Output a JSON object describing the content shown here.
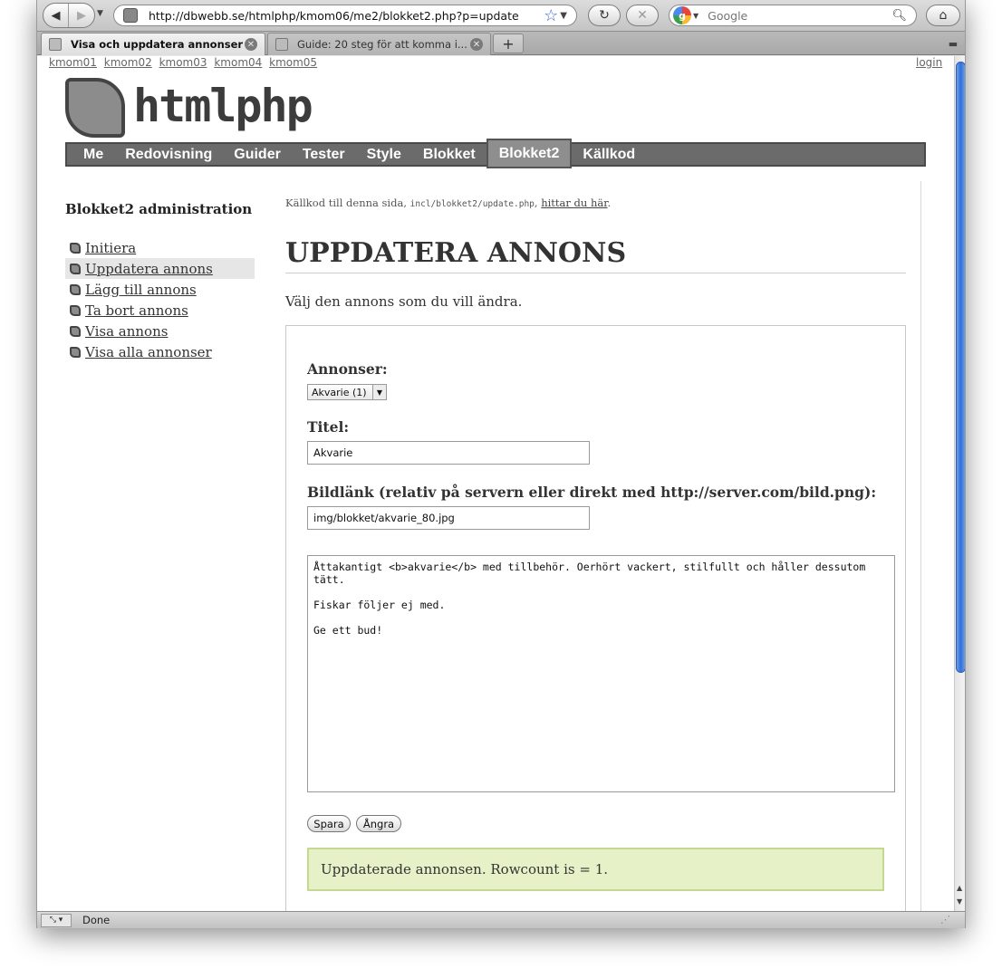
{
  "browser": {
    "url": "http://dbwebb.se/htmlphp/kmom06/me2/blokket2.php?p=update",
    "search_placeholder": "Google",
    "tabs": [
      {
        "title": "Visa och uppdatera annonser"
      },
      {
        "title": "Guide: 20 steg för att komma i..."
      }
    ],
    "status_text": "Done"
  },
  "page": {
    "topnav": [
      "kmom01",
      "kmom02",
      "kmom03",
      "kmom04",
      "kmom05"
    ],
    "login_label": "login",
    "site_title": "htmlphp",
    "mainnav": [
      "Me",
      "Redovisning",
      "Guider",
      "Tester",
      "Style",
      "Blokket",
      "Blokket2",
      "Källkod"
    ],
    "mainnav_selected": "Blokket2",
    "sidebar": {
      "title": "Blokket2 administration",
      "items": [
        {
          "label": "Initiera"
        },
        {
          "label": "Uppdatera annons"
        },
        {
          "label": "Lägg till annons"
        },
        {
          "label": "Ta bort annons"
        },
        {
          "label": "Visa annons"
        },
        {
          "label": "Visa alla annonser"
        }
      ]
    },
    "source_note": {
      "prefix": "Källkod till denna sida,",
      "file": "incl/blokket2/update.php",
      "link": "hittar du här"
    },
    "heading": "UPPDATERA ANNONS",
    "intro": "Välj den annons som du vill ändra.",
    "form": {
      "ads_label": "Annonser:",
      "ads_selected": "Akvarie (1)",
      "title_label": "Titel:",
      "title_value": "Akvarie",
      "image_label": "Bildlänk (relativ på servern eller direkt med http://server.com/bild.png):",
      "image_value": "img/blokket/akvarie_80.jpg",
      "description": "Åttakantigt <b>akvarie</b> med tillbehör. Oerhört vackert, stilfullt och håller dessutom tätt.\n\nFiskar följer ej med.\n\nGe ett bud!",
      "save_label": "Spara",
      "undo_label": "Ångra"
    },
    "status_message": "Uppdaterade annonsen. Rowcount is = 1."
  }
}
